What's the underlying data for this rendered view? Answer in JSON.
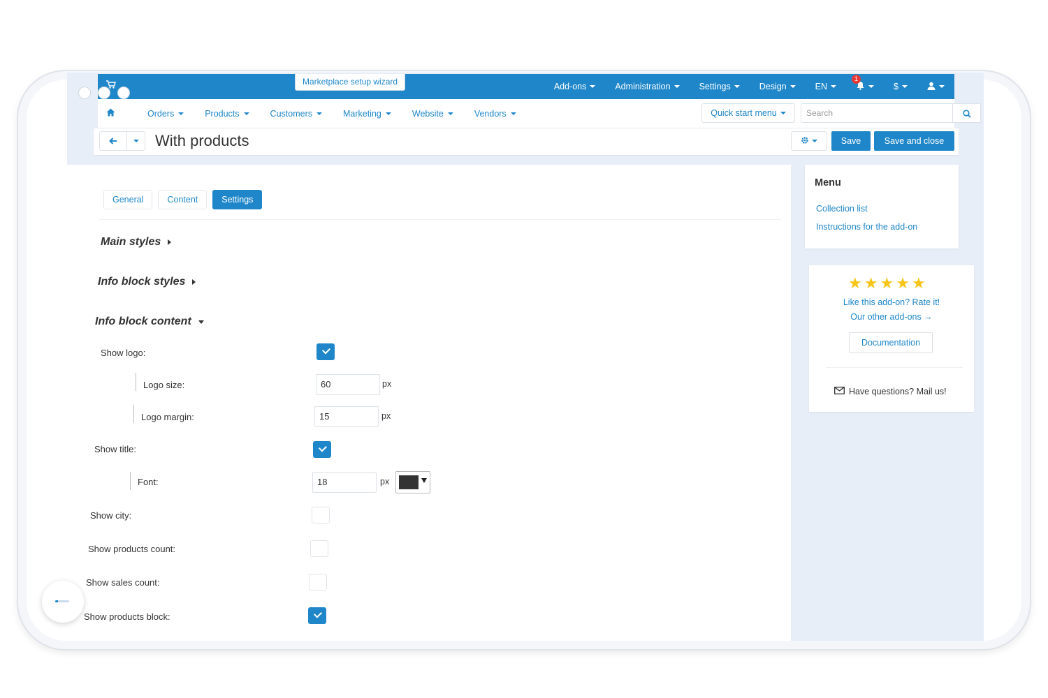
{
  "topbar": {
    "wizard_label": "Marketplace setup wizard",
    "items": [
      {
        "label": "Add-ons",
        "icon": "chevron-down-icon"
      },
      {
        "label": "Administration",
        "icon": "chevron-down-icon"
      },
      {
        "label": "Settings",
        "icon": "chevron-down-icon"
      },
      {
        "label": "Design",
        "icon": "chevron-down-icon"
      },
      {
        "label": "EN",
        "icon": "chevron-down-icon"
      }
    ],
    "notification_count": "1",
    "currency": "$"
  },
  "nav": {
    "items": [
      "Orders",
      "Products",
      "Customers",
      "Marketing",
      "Website",
      "Vendors"
    ],
    "quick_start": "Quick start menu",
    "search_placeholder": "Search"
  },
  "page": {
    "title": "With products",
    "save_label": "Save",
    "save_close_label": "Save and close"
  },
  "tabs": [
    "General",
    "Content",
    "Settings"
  ],
  "sections": {
    "main_styles": "Main styles",
    "info_block_styles": "Info block styles",
    "info_block_content": "Info block content"
  },
  "fields": {
    "show_logo": "Show logo:",
    "logo_size": "Logo size:",
    "logo_size_value": "60",
    "logo_margin": "Logo margin:",
    "logo_margin_value": "15",
    "show_title": "Show title:",
    "font": "Font:",
    "font_value": "18",
    "font_color": "#333333",
    "unit": "px",
    "show_city": "Show city:",
    "show_products_count": "Show products count:",
    "show_sales_count": "Show sales count:",
    "show_products_block": "Show products block:"
  },
  "checkbox_states": {
    "show_logo": true,
    "show_title": true,
    "show_city": false,
    "show_products_count": false,
    "show_sales_count": false,
    "show_products_block": true
  },
  "sidebar": {
    "menu_title": "Menu",
    "links": [
      "Collection list",
      "Instructions for the add-on"
    ],
    "rating_stars": 5,
    "rate_text": "Like this add-on? Rate it!",
    "other_addons": "Our other add-ons →",
    "documentation": "Documentation",
    "mail_text": "Have questions? Mail us!"
  },
  "colors": {
    "accent": "#1f87c9",
    "star": "#f6c518",
    "badge": "#e53935"
  }
}
